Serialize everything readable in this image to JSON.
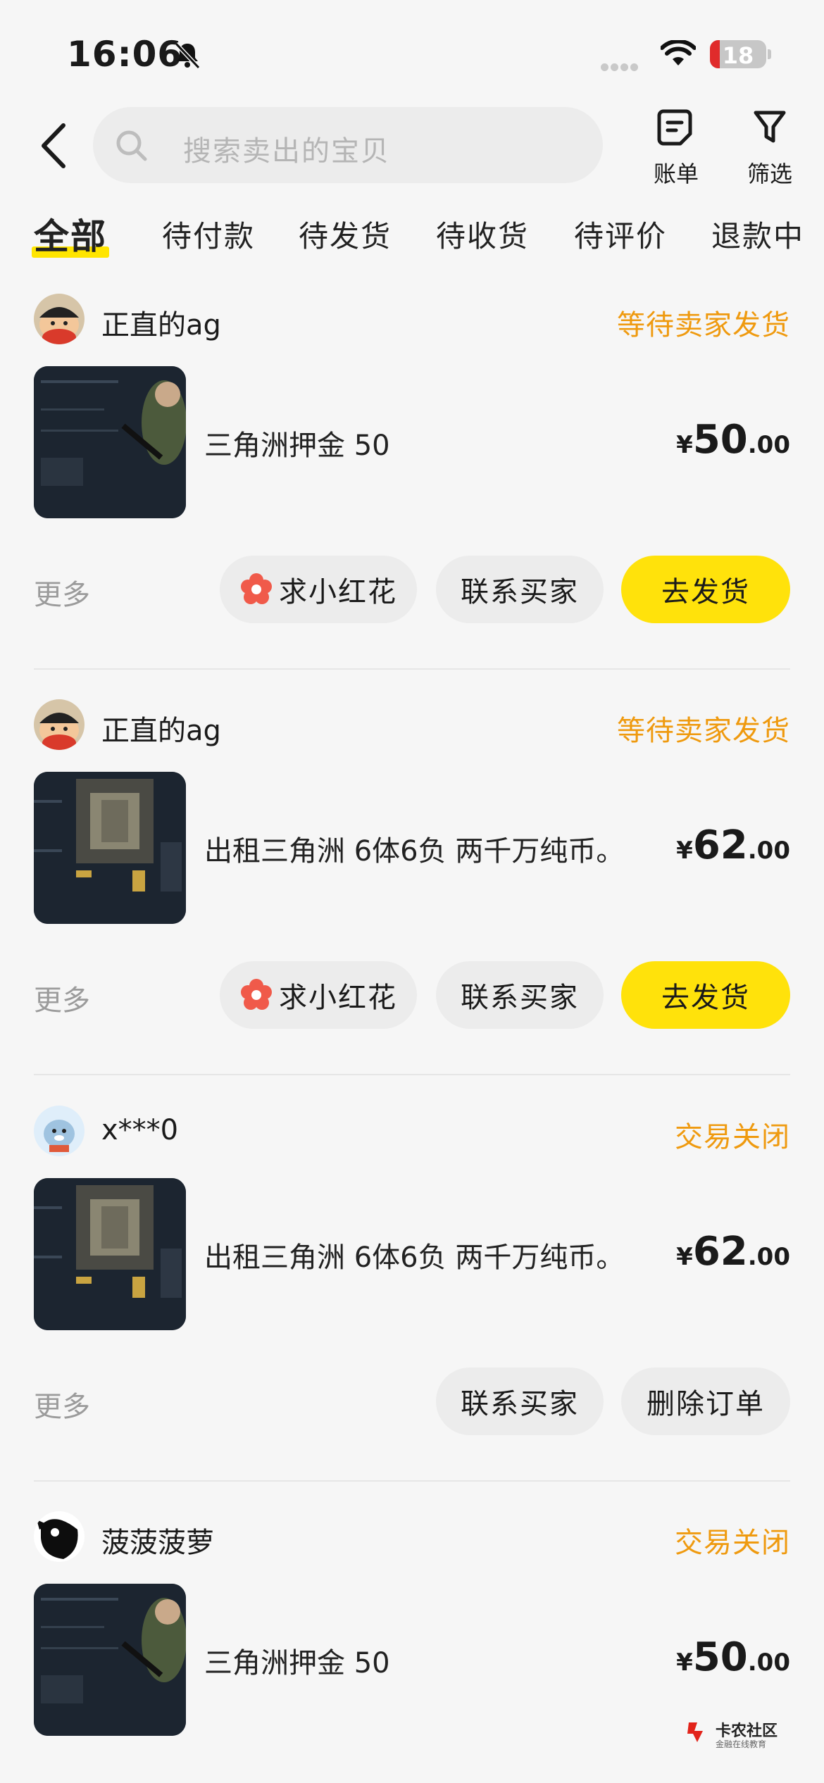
{
  "status_bar": {
    "time": "16:06",
    "battery": "18"
  },
  "search": {
    "placeholder": "搜索卖出的宝贝"
  },
  "header": {
    "bill_label": "账单",
    "filter_label": "筛选"
  },
  "tabs": [
    "全部",
    "待付款",
    "待发货",
    "待收货",
    "待评价",
    "退款中"
  ],
  "orders": [
    {
      "seller": "正直的ag",
      "status": "等待卖家发货",
      "title": "三角洲押金 50",
      "currency": "¥",
      "price_int": "50",
      "price_dec": ".00",
      "more": "更多",
      "buttons": [
        "求小红花",
        "联系买家",
        "去发货"
      ]
    },
    {
      "seller": "正直的ag",
      "status": "等待卖家发货",
      "title": "出租三角洲 6体6负 两千万纯币。",
      "currency": "¥",
      "price_int": "62",
      "price_dec": ".00",
      "more": "更多",
      "buttons": [
        "求小红花",
        "联系买家",
        "去发货"
      ]
    },
    {
      "seller": "x***0",
      "status": "交易关闭",
      "title": "出租三角洲 6体6负 两千万纯币。",
      "currency": "¥",
      "price_int": "62",
      "price_dec": ".00",
      "more": "更多",
      "buttons": [
        "联系买家",
        "删除订单"
      ]
    },
    {
      "seller": "菠菠菠萝",
      "status": "交易关闭",
      "title": "三角洲押金 50",
      "currency": "¥",
      "price_int": "50",
      "price_dec": ".00"
    }
  ],
  "watermark": {
    "title": "卡农社区",
    "subtitle": "金融在线教育"
  },
  "colors": {
    "accent_yellow": "#ffe20b",
    "status_orange": "#ef9a0f",
    "background": "#f6f6f6"
  }
}
